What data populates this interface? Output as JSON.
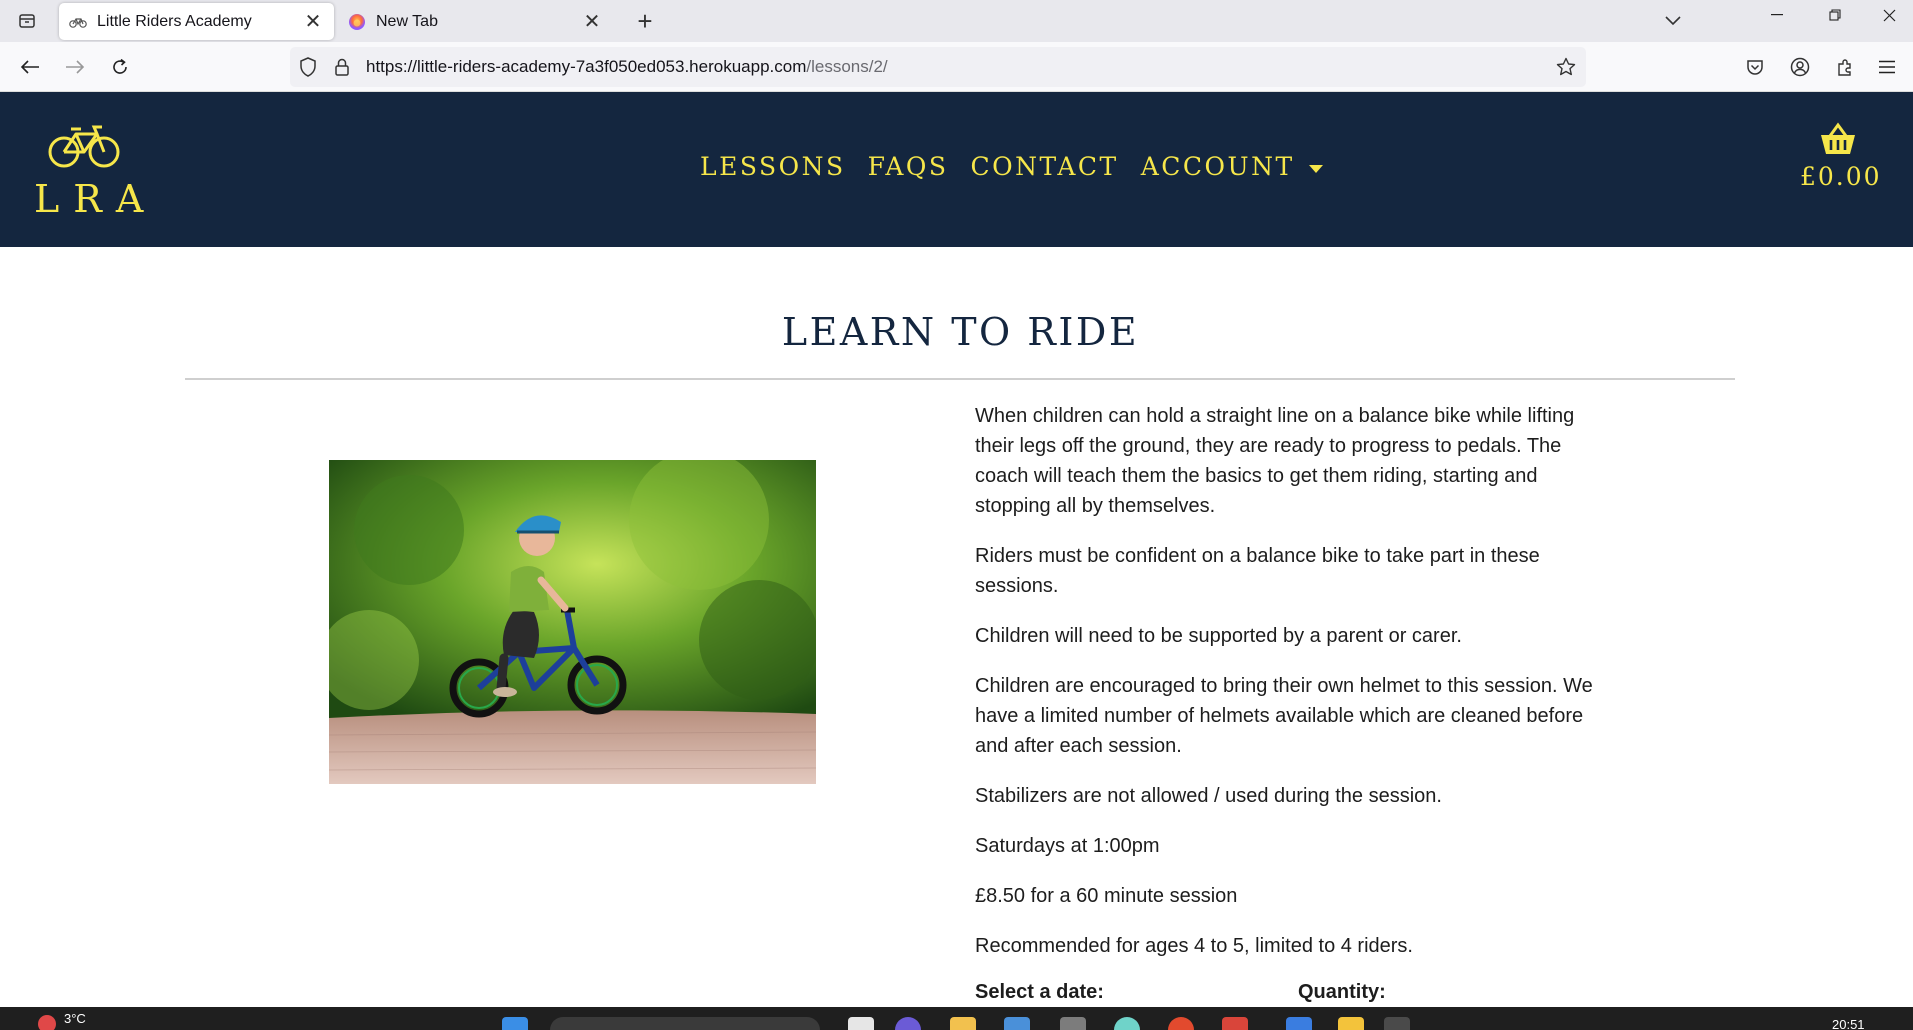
{
  "browser": {
    "tabs": [
      {
        "title": "Little Riders Academy",
        "active": true,
        "icon": "bicycle-icon"
      },
      {
        "title": "New Tab",
        "active": false,
        "icon": "firefox-icon"
      }
    ],
    "new_tab_label": "+",
    "close_glyph": "✕",
    "url": {
      "host": "https://little-riders-academy-7a3f050ed053.herokuapp.com",
      "path": "/lessons/2/"
    }
  },
  "site": {
    "logo_text": "LRA",
    "nav": [
      {
        "label": "LESSONS"
      },
      {
        "label": "FAQS"
      },
      {
        "label": "CONTACT"
      },
      {
        "label": "ACCOUNT",
        "dropdown": true
      }
    ],
    "basket_total": "£0.00",
    "colors": {
      "header_bg": "#14263f",
      "accent": "#f6e64a"
    }
  },
  "lesson": {
    "title": "LEARN TO RIDE",
    "paragraphs": [
      "When children can hold a straight line on a balance bike while lifting their legs off the ground, they are ready to progress to pedals. The coach will teach them the basics to get them riding, starting and stopping all by themselves.",
      "Riders must be confident on a balance bike to take part in these sessions.",
      "Children will need to be supported by a parent or carer.",
      "Children are encouraged to bring their own helmet to this session. We have a limited number of helmets available which are cleaned before and after each session.",
      "Stabilizers are not allowed / used during the session.",
      "Saturdays at 1:00pm",
      "£8.50 for a 60 minute session",
      "Recommended for ages 4 to 5, limited to 4 riders."
    ],
    "form": {
      "date_label": "Select a date:",
      "quantity_label": "Quantity:"
    }
  },
  "taskbar": {
    "weather": "3°C",
    "time": "20:51"
  }
}
